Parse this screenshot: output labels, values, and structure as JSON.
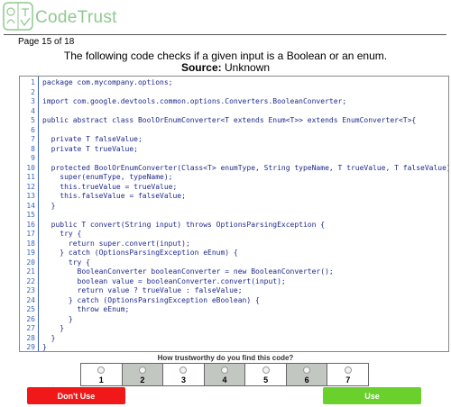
{
  "header": {
    "brand": "CodeTrust",
    "page": "Page 15 of 18"
  },
  "prompt": {
    "title": "The following code checks if a given input is a Boolean or an enum.",
    "source_label": "Source:",
    "source_value": "Unknown"
  },
  "code": {
    "lines": [
      "package com.mycompany.options;",
      "",
      "import com.google.devtools.common.options.Converters.BooleanConverter;",
      "",
      "public abstract class BoolOrEnumConverter<T extends Enum<T>> extends EnumConverter<T>{",
      "",
      "  private T falseValue;",
      "  private T trueValue;",
      "",
      "  protected BoolOrEnumConverter(Class<T> enumType, String typeName, T trueValue, T falseValue) {",
      "    super(enumType, typeName);",
      "    this.trueValue = trueValue;",
      "    this.falseValue = falseValue;",
      "  }",
      "",
      "  public T convert(String input) throws OptionsParsingException {",
      "    try {",
      "      return super.convert(input);",
      "    } catch (OptionsParsingException eEnum) {",
      "      try {",
      "        BooleanConverter booleanConverter = new BooleanConverter();",
      "        boolean value = booleanConverter.convert(input);",
      "        return value ? trueValue : falseValue;",
      "      } catch (OptionsParsingException eBoolean) {",
      "        throw eEnum;",
      "      }",
      "    }",
      "  }",
      "}"
    ]
  },
  "rating": {
    "question": "How trustworthy do you find this code?",
    "options": [
      "1",
      "2",
      "3",
      "4",
      "5",
      "6",
      "7"
    ],
    "shaded": [
      false,
      true,
      false,
      true,
      false,
      true,
      false
    ]
  },
  "buttons": {
    "dont_use": "Don't Use",
    "use": "Use"
  },
  "colors": {
    "brand": "#8fc98f",
    "dont_use": "#f01818",
    "use": "#6ad02c",
    "code_text": "#1f2a8c",
    "line_numbers": "#3b67b9"
  }
}
